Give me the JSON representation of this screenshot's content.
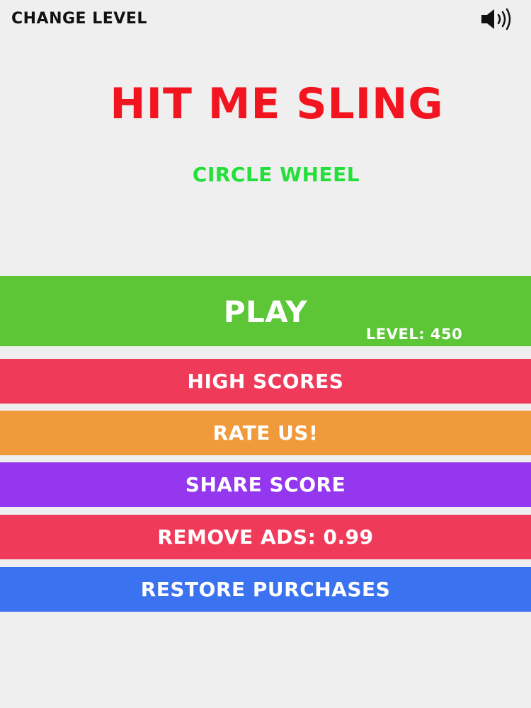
{
  "header": {
    "change_level_label": "CHANGE LEVEL",
    "sound_icon": "speaker-volume-icon"
  },
  "title": {
    "text": "HIT ME SLING",
    "color": "#f2151f"
  },
  "subtitle": {
    "text": "CIRCLE WHEEL",
    "color": "#22e039"
  },
  "menu": {
    "play": {
      "label": "PLAY",
      "level_text": "LEVEL: 450",
      "color": "#5cc636"
    },
    "high_scores": {
      "label": "HIGH SCORES",
      "color": "#f03a5a"
    },
    "rate_us": {
      "label": "RATE US!",
      "color": "#f09a3b"
    },
    "share_score": {
      "label": "SHARE SCORE",
      "color": "#9437ef"
    },
    "remove_ads": {
      "label": "REMOVE ADS: 0.99",
      "color": "#f03a5a"
    },
    "restore_purchases": {
      "label": "RESTORE PURCHASES",
      "color": "#3a72ef"
    }
  }
}
